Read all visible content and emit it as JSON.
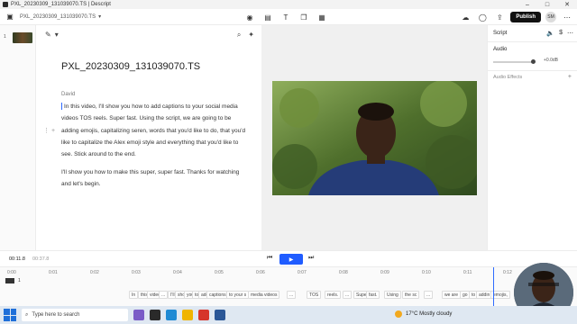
{
  "window": {
    "title": "PXL_20230309_131039070.TS | Descript",
    "minimize": "–",
    "maximize": "□",
    "close": "✕"
  },
  "toolbar": {
    "file_name": "PXL_20230309_131039070.TS",
    "publish_label": "Publish",
    "avatar_initials": "SM"
  },
  "scenes": {
    "items": [
      {
        "number": "1"
      }
    ]
  },
  "script": {
    "title": "PXL_20230309_131039070.TS",
    "speaker": "David",
    "paragraphs": [
      "In this video, I'll show you how to add captions to your social media videos TOS reels. Super fast. Using the script, we are going to be adding emojis, capitalizing seren, words that you'd like to do, that you'd like to capitalize the Alex emoji style and everything that you'd like to see. Stick around to the end.",
      "I'll show you how to make this super, super fast. Thanks for watching and let's begin."
    ]
  },
  "inspector": {
    "tab_label": "Script",
    "audio_label": "Audio",
    "volume_value": "+0.0dB",
    "audio_effects_label": "Audio Effects"
  },
  "transport": {
    "current_time": "00:11.8",
    "total_time": "00:37.8"
  },
  "timeline": {
    "ruler_ticks": [
      "0:00",
      "0:01",
      "0:02",
      "0:03",
      "0:04",
      "0:05",
      "0:06",
      "0:07",
      "0:08",
      "0:09",
      "0:10",
      "0:11",
      "0:12"
    ],
    "track_number": "1",
    "words": [
      "In",
      "this",
      "video",
      "...",
      "I'll",
      "show",
      "you",
      "to",
      "add",
      "captions",
      "to your s",
      "media videos",
      "...",
      "TOS",
      "reels.",
      "...",
      "Super",
      "fast.",
      "Using",
      "the sc",
      "...",
      "we are",
      "go",
      "to",
      "addin",
      "emojis,"
    ]
  },
  "taskbar": {
    "search_placeholder": "Type here to search",
    "weather": "17°C  Mostly cloudy"
  }
}
